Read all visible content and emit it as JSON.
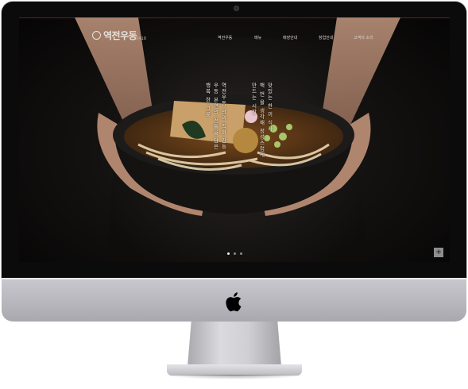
{
  "site": {
    "logo_text": "역전우동",
    "logo_subtext": "0410"
  },
  "nav": {
    "items": [
      {
        "label": "역전우동"
      },
      {
        "label": "메뉴"
      },
      {
        "label": "매장안내"
      },
      {
        "label": "창업안내"
      },
      {
        "label": "고객의 소리"
      }
    ]
  },
  "hero": {
    "copy_lines": [
      "역전우동 만의 직화 감동",
      "우동 본연의 전통을 담은",
      "행복 한 그릇",
      "",
      "맛있는 한 끼 식사",
      "백 번 을 생각해 정성스럽게",
      "만드는 시간"
    ],
    "slider_dots": 3,
    "active_dot": 1
  },
  "controls": {
    "plus_label": "+"
  },
  "colors": {
    "accent_line": "#6b1b16",
    "screen_bg": "#0b0b0b",
    "chin": "#c0bfc6"
  },
  "icons": {
    "apple": "apple-logo-icon",
    "logo_mark": "bowl-mark-icon"
  }
}
